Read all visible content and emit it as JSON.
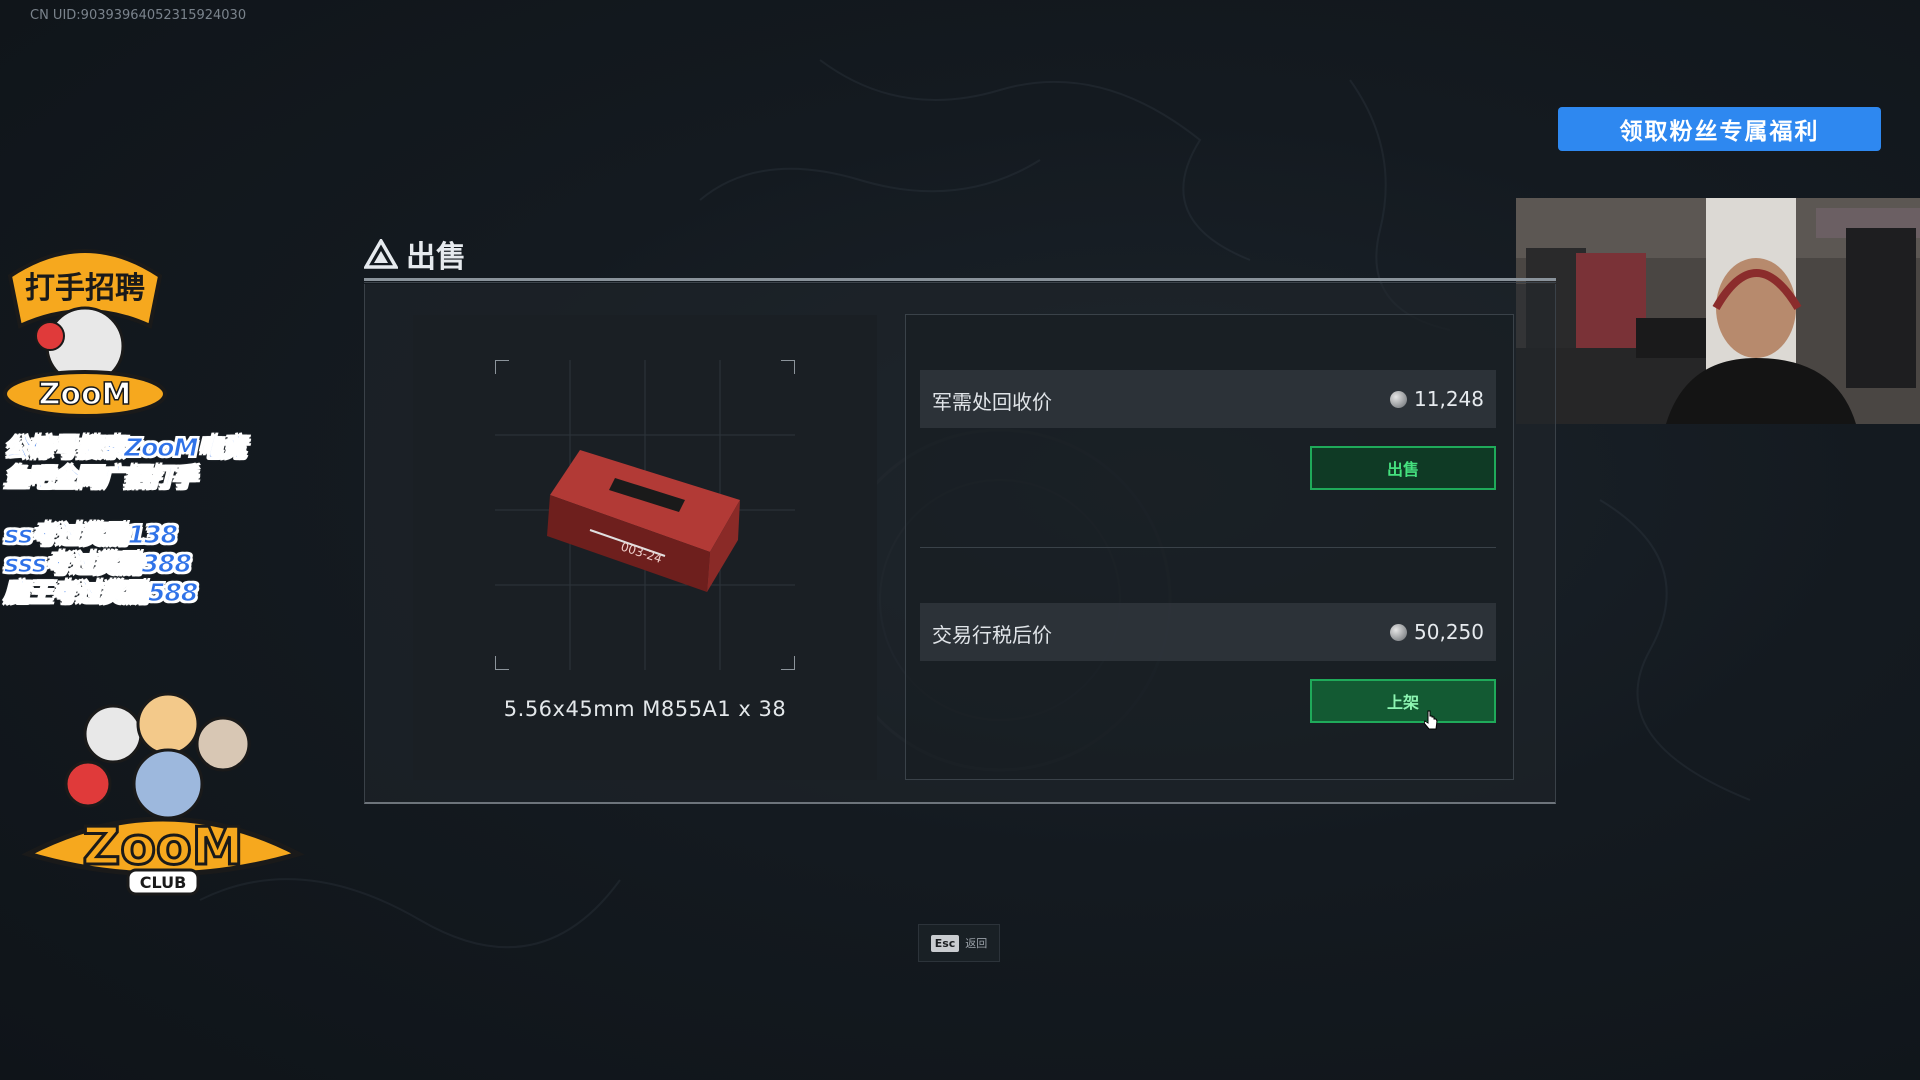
{
  "overlay": {
    "uid": "CN UID:90393964052315924030",
    "fan_button": "领取粉丝专属福利",
    "recruit_badge": "打手招聘",
    "logo_text": "ZooM",
    "logo_sub": "CLUB",
    "promo_lines": [
      "公棕号搜索ZooM电竞",
      "鱼吧全网广招打手"
    ],
    "reward_lines": [
      "ss考过奖励138",
      "sss考过奖励388",
      "魔王考过奖励588"
    ]
  },
  "sell": {
    "title": "出售",
    "item_name": "5.56x45mm M855A1 x 38",
    "item_box_text": "003-24",
    "recycle_label": "军需处回收价",
    "recycle_value": "11,248",
    "sell_button": "出售",
    "market_label": "交易行税后价",
    "market_value": "50,250",
    "list_button": "上架"
  },
  "footer": {
    "esc_key": "Esc",
    "esc_label": "返回"
  },
  "colors": {
    "accent_blue": "#2e88f0",
    "button_green": "#1faa5a"
  }
}
